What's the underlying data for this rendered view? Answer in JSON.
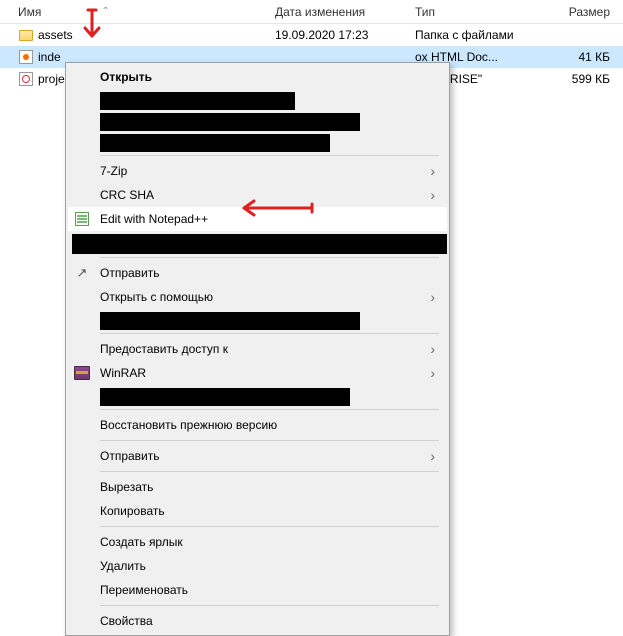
{
  "columns": {
    "name": "Имя",
    "date": "Дата изменения",
    "type": "Тип",
    "size": "Размер"
  },
  "files": [
    {
      "name": "assets",
      "date": "19.09.2020 17:23",
      "type": "Папка с файлами",
      "size": ""
    },
    {
      "name": "inde",
      "date": "",
      "type": "ox HTML Doc...",
      "size": "41 КБ"
    },
    {
      "name": "proje",
      "date": "",
      "type": "\"MOBIRISE\"",
      "size": "599 КБ"
    }
  ],
  "menu": {
    "open": "Открыть",
    "sevenzip": "7-Zip",
    "crcsha": "CRC SHA",
    "notepadpp": "Edit with Notepad++",
    "send": "Отправить",
    "openwith": "Открыть с помощью",
    "grantaccess": "Предоставить доступ к",
    "winrar": "WinRAR",
    "restore": "Восстановить прежнюю версию",
    "send2": "Отправить",
    "cut": "Вырезать",
    "copy": "Копировать",
    "shortcut": "Создать ярлык",
    "delete": "Удалить",
    "rename": "Переименовать",
    "properties": "Свойства"
  }
}
